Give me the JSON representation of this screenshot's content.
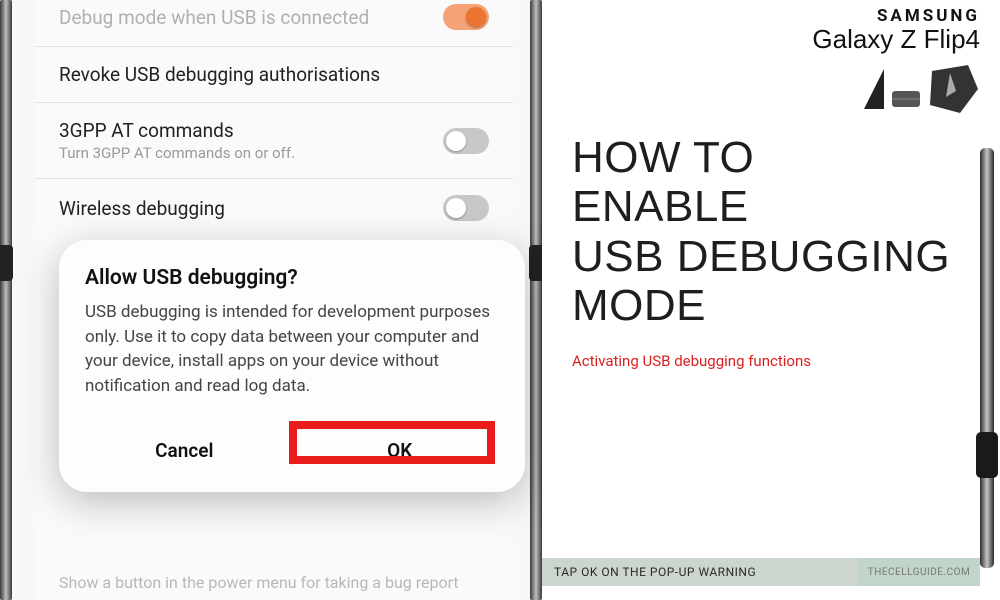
{
  "settings": {
    "item0": {
      "title": "Debug mode when USB is connected"
    },
    "item1": {
      "title": "Revoke USB debugging authorisations"
    },
    "item2": {
      "title": "3GPP AT commands",
      "sub": "Turn 3GPP AT commands on or off."
    },
    "item3": {
      "title": "Wireless debugging"
    }
  },
  "dialog": {
    "title": "Allow USB debugging?",
    "body": "USB debugging is intended for development purposes only. Use it to copy data between your computer and your device, install apps on your device without notification and read log data.",
    "cancel": "Cancel",
    "ok": "OK"
  },
  "behind_text": "Show a button in the power menu for taking a bug report",
  "right": {
    "brand": "SAMSUNG",
    "model": "Galaxy Z Flip4",
    "headline_l1": "HOW TO",
    "headline_l2": "ENABLE",
    "headline_l3": "USB DEBUGGING",
    "headline_l4": "MODE",
    "sub": "Activating USB debugging functions"
  },
  "caption": {
    "main": "TAP OK ON THE POP-UP WARNING",
    "site": "THECELLGUIDE.COM"
  },
  "colors": {
    "highlight": "#ea1c1c",
    "accent_toggle": "#eb7430"
  }
}
